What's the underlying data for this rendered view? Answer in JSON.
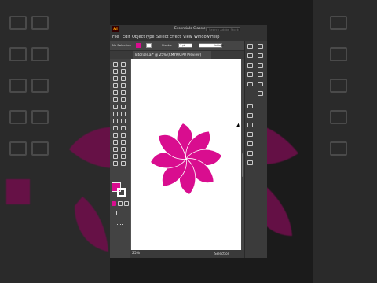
{
  "app": {
    "logo": "Ai",
    "workspace": "Essentials Classic",
    "search_placeholder": "Search Adobe Stock"
  },
  "menu": [
    "File",
    "Edit",
    "Object",
    "Type",
    "Select",
    "Effect",
    "View",
    "Window",
    "Help"
  ],
  "control_bar": {
    "selection_label": "No Selection",
    "stroke_label": "Stroke:",
    "stroke_value": "1 pt",
    "profile_label": "Uniform",
    "fill_color": "#d90d8f"
  },
  "document_tab": {
    "title": "Tutorials.ai* @ 25% (CMYK/GPU Preview)"
  },
  "status_bar": {
    "zoom": "25%",
    "selection": "Selection"
  },
  "artwork": {
    "flower_color": "#d90d8f",
    "flower_stroke": "#ffffff",
    "petal_count": 8
  }
}
